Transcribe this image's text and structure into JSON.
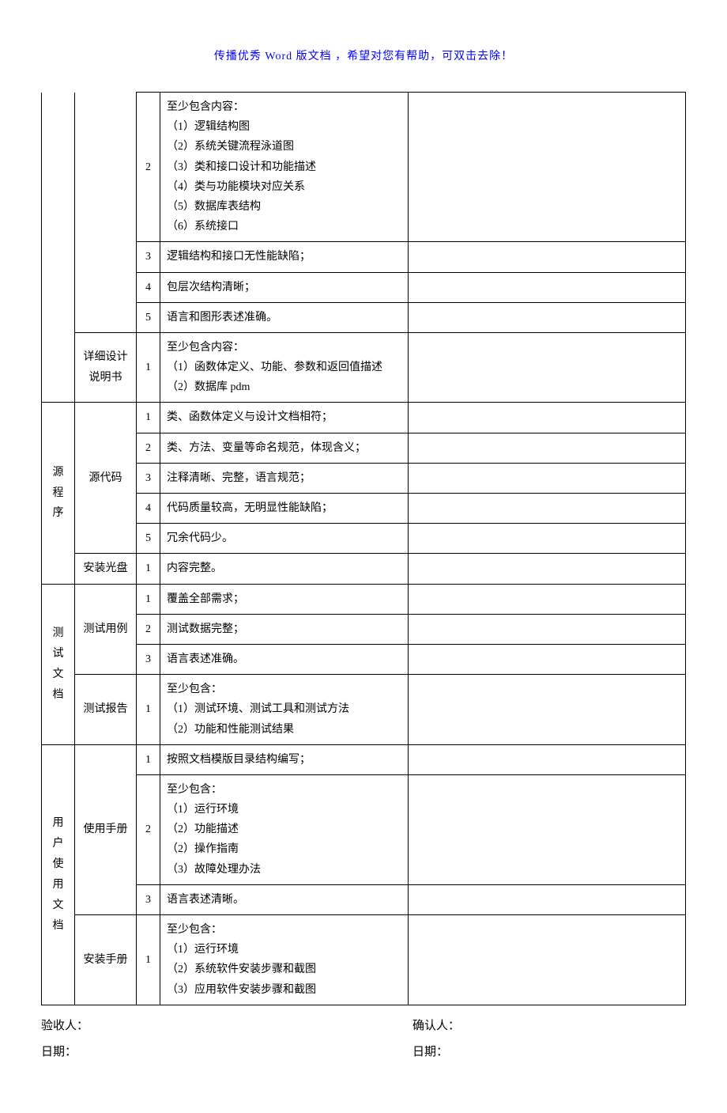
{
  "header_note": "传播优秀 Word 版文档 ，希望对您有帮助，可双击去除！",
  "categories": {
    "cat1_sub2": "详细设计说明书",
    "cat2": "源程序",
    "cat2_sub1": "源代码",
    "cat2_sub2": "安装光盘",
    "cat3": "测试文档",
    "cat3_sub1": "测试用例",
    "cat3_sub2": "测试报告",
    "cat4": "用户使用文档",
    "cat4_sub1": "使用手册",
    "cat4_sub2": "安装手册"
  },
  "rows": {
    "r1": "至少包含内容：\n（1）逻辑结构图\n（2）系统关键流程泳道图\n（3）类和接口设计和功能描述\n（4）类与功能模块对应关系\n（5）数据库表结构\n（6）系统接口",
    "r2": "逻辑结构和接口无性能缺陷；",
    "r3": "包层次结构清晰；",
    "r4": "语言和图形表述准确。",
    "r5": "至少包含内容：\n（1）函数体定义、功能、参数和返回值描述\n（2）数据库 pdm",
    "r6": "类、函数体定义与设计文档相符；",
    "r7": "类、方法、变量等命名规范，体现含义；",
    "r8": "注释清晰、完整，语言规范；",
    "r9": "代码质量较高，无明显性能缺陷；",
    "r10": "冗余代码少。",
    "r11": "内容完整。",
    "r12": "覆盖全部需求；",
    "r13": "测试数据完整；",
    "r14": "语言表述准确。",
    "r15": "至少包含：\n（1）测试环境、测试工具和测试方法\n（2）功能和性能测试结果",
    "r16": "按照文档模版目录结构编写；",
    "r17": "至少包含：\n（1）运行环境\n（2）功能描述\n（2）操作指南\n（3）故障处理办法",
    "r18": "语言表述清晰。",
    "r19": "至少包含：\n（1）运行环境\n（2）系统软件安装步骤和截图\n（3）应用软件安装步骤和截图"
  },
  "nums": {
    "n2": "2",
    "n3": "3",
    "n4": "4",
    "n5": "5",
    "n1": "1"
  },
  "footer": {
    "reviewer": "验收人：",
    "confirmer": "确认人：",
    "date": "日期："
  }
}
